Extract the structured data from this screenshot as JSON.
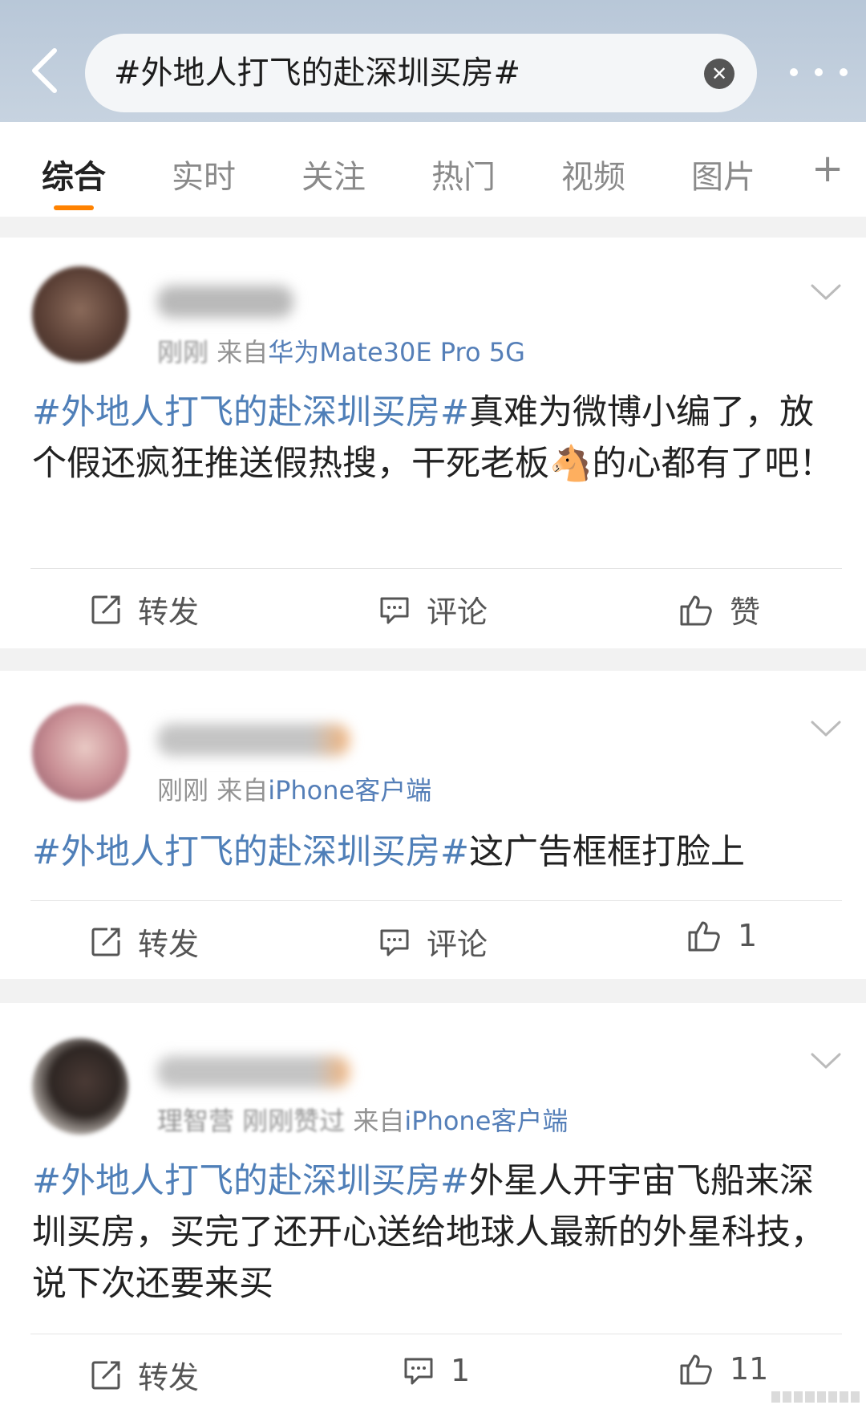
{
  "search": {
    "query": "#外地人打飞的赴深圳买房#"
  },
  "tabs": [
    "综合",
    "实时",
    "关注",
    "热门",
    "视频",
    "图片"
  ],
  "active_tab": "综合",
  "colors": {
    "accent": "#ff8200",
    "topic": "#4f7fb8",
    "header": "#bccada"
  },
  "posts": [
    {
      "time": "刚刚",
      "from_label": "来自",
      "device": "华为Mate30E Pro 5G",
      "topic": "#外地人打飞的赴深圳买房#",
      "text": "真难为微博小编了，放个假还疯狂推送假热搜，干死老板",
      "emoji": "🐴",
      "text_after": "的心都有了吧！",
      "repost_label": "转发",
      "comment_label": "评论",
      "like_label": "赞"
    },
    {
      "time": "刚刚",
      "from_label": "来自",
      "device": "iPhone客户端",
      "topic": "#外地人打飞的赴深圳买房#",
      "text": "这广告框框打脸上",
      "repost_label": "转发",
      "comment_label": "评论",
      "like_count": "1"
    },
    {
      "time": "理智营 刚刚赞过",
      "from_label": "来自",
      "device": "iPhone客户端",
      "topic": "#外地人打飞的赴深圳买房#",
      "text": "外星人开宇宙飞船来深圳买房，买完了还开心送给地球人最新的外星科技，说下次还要来买",
      "repost_label": "转发",
      "comment_count": "1",
      "like_count": "11"
    }
  ]
}
